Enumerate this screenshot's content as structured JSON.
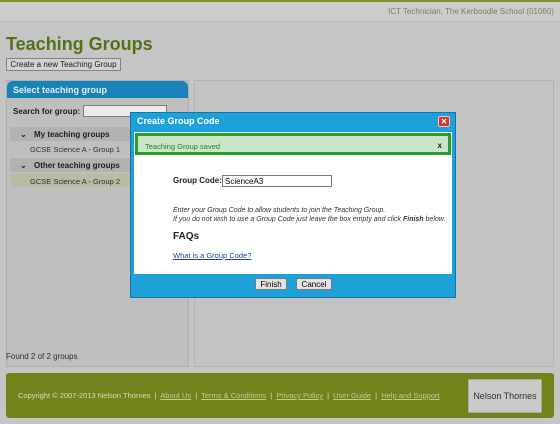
{
  "header": {
    "user_info": "ICT Technician, The Kerboodle School (01060)"
  },
  "page": {
    "title": "Teaching Groups",
    "create_button": "Create a new Teaching Group"
  },
  "sidebar": {
    "title": "Select teaching group",
    "search_label": "Search for group:",
    "search_value": "",
    "sections": [
      {
        "label": "My teaching groups",
        "items": [
          "GCSE Science A - Group 1"
        ]
      },
      {
        "label": "Other teaching groups",
        "items": [
          "GCSE Science A - Group 2"
        ]
      }
    ],
    "found_text": "Found 2 of 2 groups"
  },
  "footer": {
    "copyright": "Copyright © 2007-2013 Nelson Thornes",
    "links": [
      "About Us",
      "Terms & Conditions",
      "Privacy Policy",
      "User Guide",
      "Help and Support"
    ],
    "logo_text": "Nelson Thornes"
  },
  "modal": {
    "title": "Create Group Code",
    "close": "✕",
    "alert_text": "Teaching Group saved",
    "alert_dismiss": "x",
    "group_code_label": "Group Code:",
    "group_code_value": "ScienceA3",
    "instruction_line1": "Enter your Group Code to allow students to join the Teaching Group.",
    "instruction_line2_prefix": "If you do not wish to use a Group Code just leave the box empty and click ",
    "instruction_line2_bold": "Finish",
    "instruction_line2_suffix": " below.",
    "faqs_heading": "FAQs",
    "faq_link": "What is a Group Code?",
    "finish_label": "Finish",
    "cancel_label": "Cancel"
  },
  "colors": {
    "accent_green": "#5d7a1a",
    "accent_blue": "#1ea0d8",
    "alert_green": "#25a02a",
    "footer_green": "#7b901f",
    "close_red": "#cc3a2e"
  }
}
